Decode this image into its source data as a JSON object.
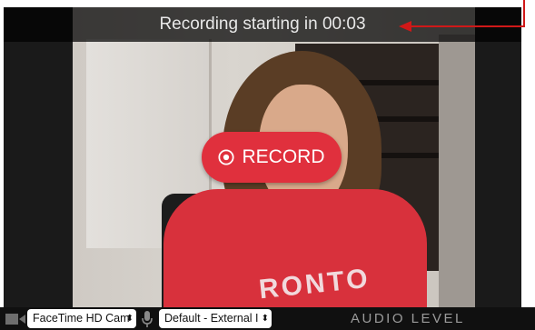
{
  "banner": {
    "countdown_text": "Recording starting in 00:03"
  },
  "record_button": {
    "label": "RECORD",
    "icon": "record-icon"
  },
  "controls": {
    "camera_icon": "video-camera-icon",
    "camera_select": "FaceTime HD Cam",
    "mic_icon": "microphone-icon",
    "audio_select": "Default - External I",
    "audio_level_label": "AUDIO LEVEL"
  },
  "video_preview": {
    "shirt_text": "RONTO"
  },
  "colors": {
    "record_red": "#e0303d",
    "annotation_red": "#d01818",
    "bar_bg": "#101010"
  }
}
